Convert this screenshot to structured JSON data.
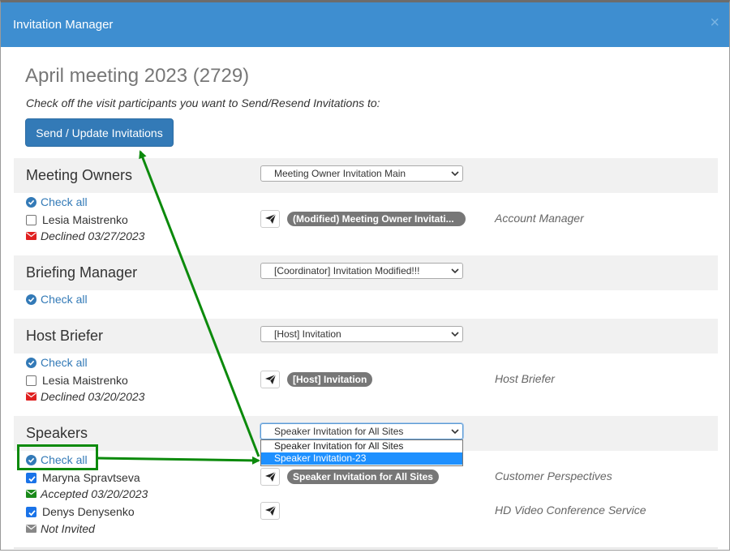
{
  "window": {
    "title": "Invitation Manager",
    "close_glyph": "×"
  },
  "meeting": {
    "title": "April meeting 2023 (2729)",
    "instructions": "Check off the visit participants you want to Send/Resend Invitations to:",
    "send_button": "Send / Update Invitations"
  },
  "groups": [
    {
      "name": "Meeting Owners",
      "template": "Meeting Owner Invitation Main",
      "check_all": "Check all",
      "participants": [
        {
          "name": "Lesia Maistrenko",
          "checked": false,
          "status": "Declined 03/27/2023",
          "status_color": "#e02020",
          "invitation": "(Modified) Meeting Owner Invitati...",
          "role": "Account Manager"
        }
      ]
    },
    {
      "name": "Briefing Manager",
      "template": "[Coordinator] Invitation Modified!!!",
      "check_all": "Check all",
      "participants": []
    },
    {
      "name": "Host Briefer",
      "template": "[Host] Invitation",
      "check_all": "Check all",
      "participants": [
        {
          "name": "Lesia Maistrenko",
          "checked": false,
          "status": "Declined 03/20/2023",
          "status_color": "#e02020",
          "invitation": "[Host] Invitation",
          "role": "Host Briefer"
        }
      ]
    },
    {
      "name": "Speakers",
      "template": "Speaker Invitation for All Sites",
      "template_options": [
        "Speaker Invitation for All Sites",
        "Speaker Invitation-23"
      ],
      "highlighted_option": "Speaker Invitation-23",
      "check_all": "Check all",
      "participants": [
        {
          "name": "Maryna Spravtseva",
          "checked": true,
          "status": "Accepted 03/20/2023",
          "status_color": "#1a8a1a",
          "invitation": "Speaker Invitation for All Sites",
          "role": "Customer Perspectives"
        },
        {
          "name": "Denys Denysenko",
          "checked": true,
          "status": "Not Invited",
          "status_color": "#888888",
          "invitation": "",
          "role": "HD Video Conference Service"
        }
      ]
    }
  ],
  "colors": {
    "titlebar": "#3e8ed0",
    "primary": "#337ab7",
    "annotation": "#0c8a0c",
    "badge": "#777777"
  },
  "icons": {
    "check_all": "check-circle-icon",
    "send": "paper-plane-icon",
    "status": "envelope-icon",
    "select": "chevron-down-icon"
  }
}
